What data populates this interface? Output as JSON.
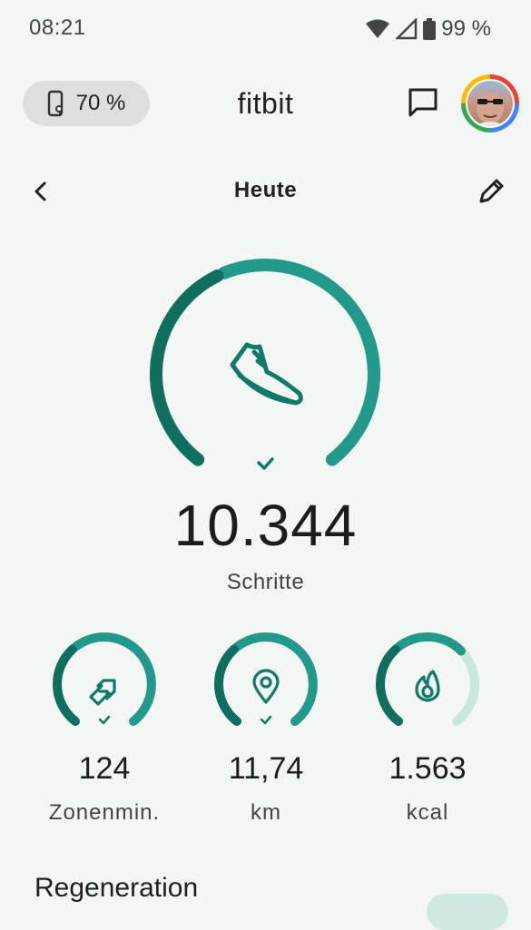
{
  "status_bar": {
    "time": "08:21",
    "battery_text": "99 %"
  },
  "header": {
    "device_battery": "70 %",
    "brand": "fitbit"
  },
  "nav": {
    "title": "Heute"
  },
  "steps": {
    "value": "10.344",
    "label": "Schritte",
    "goal_progress": 1.0,
    "goal_met": true
  },
  "stats": [
    {
      "value": "124",
      "label": "Zonenmin.",
      "icon": "zone-arrows-icon",
      "progress": 1.0,
      "goal_met": true
    },
    {
      "value": "11,74",
      "label": "km",
      "icon": "location-pin-icon",
      "progress": 1.0,
      "goal_met": true
    },
    {
      "value": "1.563",
      "label": "kcal",
      "icon": "flame-icon",
      "progress": 0.66,
      "goal_met": false
    }
  ],
  "section": {
    "title": "Regeneration"
  },
  "colors": {
    "accent": "#1f9b8a",
    "accent_dark": "#0f6e5d",
    "track": "#c9e6df",
    "background": "#f3f6f4"
  }
}
